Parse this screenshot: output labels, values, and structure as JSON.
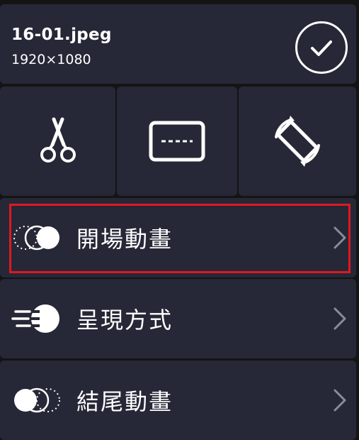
{
  "header": {
    "file_name": "16-01.jpeg",
    "resolution": "1920×1080",
    "confirm_icon": "check-circle-icon"
  },
  "tools": [
    {
      "icon": "scissors-icon"
    },
    {
      "icon": "subtitle-box-icon"
    },
    {
      "icon": "rotate-icon"
    }
  ],
  "menu": [
    {
      "label": "開場動畫",
      "icon": "fade-in-icon",
      "highlighted": true
    },
    {
      "label": "呈現方式",
      "icon": "motion-ball-icon",
      "highlighted": false
    },
    {
      "label": "結尾動畫",
      "icon": "fade-out-icon",
      "highlighted": false
    }
  ],
  "colors": {
    "background": "#141414",
    "card": "#262837",
    "text": "#ffffff",
    "chevron": "#8a8c98",
    "highlight": "#e01822"
  }
}
